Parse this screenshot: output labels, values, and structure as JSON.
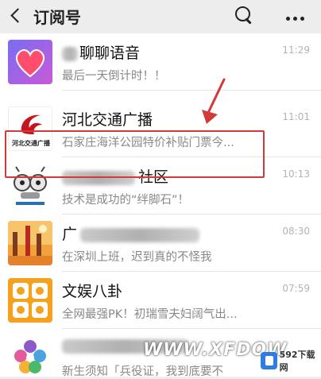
{
  "header": {
    "title": "订阅号"
  },
  "items": [
    {
      "name": "聊聊语音",
      "preview": "最后一天倒计时！！",
      "time": "11:29"
    },
    {
      "name": "河北交通广播",
      "preview": "石家庄海洋公园特价补贴门票今...",
      "time": "11:01",
      "avatar_text": "河北交通广播"
    },
    {
      "name": "社区",
      "preview": "技术是成功的“绊脚石”！",
      "time": "10:13"
    },
    {
      "name": "广",
      "preview": "在深圳上班，迟到真的不怪我",
      "time": "08:30"
    },
    {
      "name": "文娱八卦",
      "preview": "全网最强PK！初瑞雪夫妇阔气出...",
      "time": "07:59"
    },
    {
      "name": "",
      "preview": "新生须知「兵役证，我到底要不",
      "time": ""
    }
  ],
  "watermark": {
    "text": "WWW.XFDOW",
    "badge": "592下载网"
  },
  "colors": {
    "highlight": "#d23a3a",
    "background": "#ededed"
  }
}
